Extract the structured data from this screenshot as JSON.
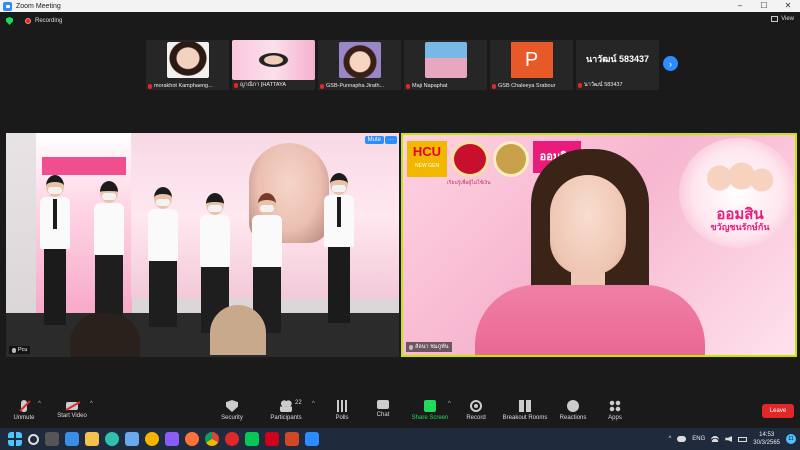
{
  "window": {
    "title": "Zoom Meeting",
    "minimize": "–",
    "maximize": "☐",
    "close": "✕"
  },
  "topbar": {
    "recording_label": "Recording",
    "view_label": "View"
  },
  "thumbnails": [
    {
      "name": "morakhot Kamphaeng..."
    },
    {
      "name": "ญาณิกา [HATTAYA"
    },
    {
      "name": "GSB-Punnapha Jirath..."
    },
    {
      "name": "Maji Napaphat"
    },
    {
      "name": "GSB Chaleeya Srabour",
      "avatar_letter": "P"
    },
    {
      "name": "นาวัฒน์ 583437",
      "display_text": "นาวัฒน์ 583437"
    }
  ],
  "tiles": {
    "left": {
      "name": "Pcu",
      "mute_label": "Mute",
      "more_label": "···"
    },
    "right": {
      "name": "ลัลนา ชมภูพัน",
      "logo_hcu": "HCU",
      "logo_hcu_sub": "NEW GEN",
      "logo_gsb": "ออมสิน",
      "caption": "เรียนรู้เพื่อผู้ไม่ใช้เงิน",
      "campaign_line1": "ออมสิน",
      "campaign_line2": "ขวัญชนรักษ์กัน"
    }
  },
  "toolbar": {
    "unmute": "Unmute",
    "start_video": "Start Video",
    "security": "Security",
    "participants": "Participants",
    "participants_count": "22",
    "polls": "Polls",
    "chat": "Chat",
    "share_screen": "Share Screen",
    "record": "Record",
    "breakout_rooms": "Breakout Rooms",
    "reactions": "Reactions",
    "apps": "Apps",
    "leave": "Leave",
    "caret": "^"
  },
  "taskbar": {
    "language": "ENG",
    "time": "14:53",
    "date": "30/3/2565",
    "notification_count": "11",
    "tray_arrow": "^"
  },
  "colors": {
    "zoom_blue": "#2d8cff",
    "leave_red": "#e02828",
    "share_green": "#23d959",
    "active_speaker_border": "#c9e600",
    "gsb_pink": "#ea1b7a"
  }
}
